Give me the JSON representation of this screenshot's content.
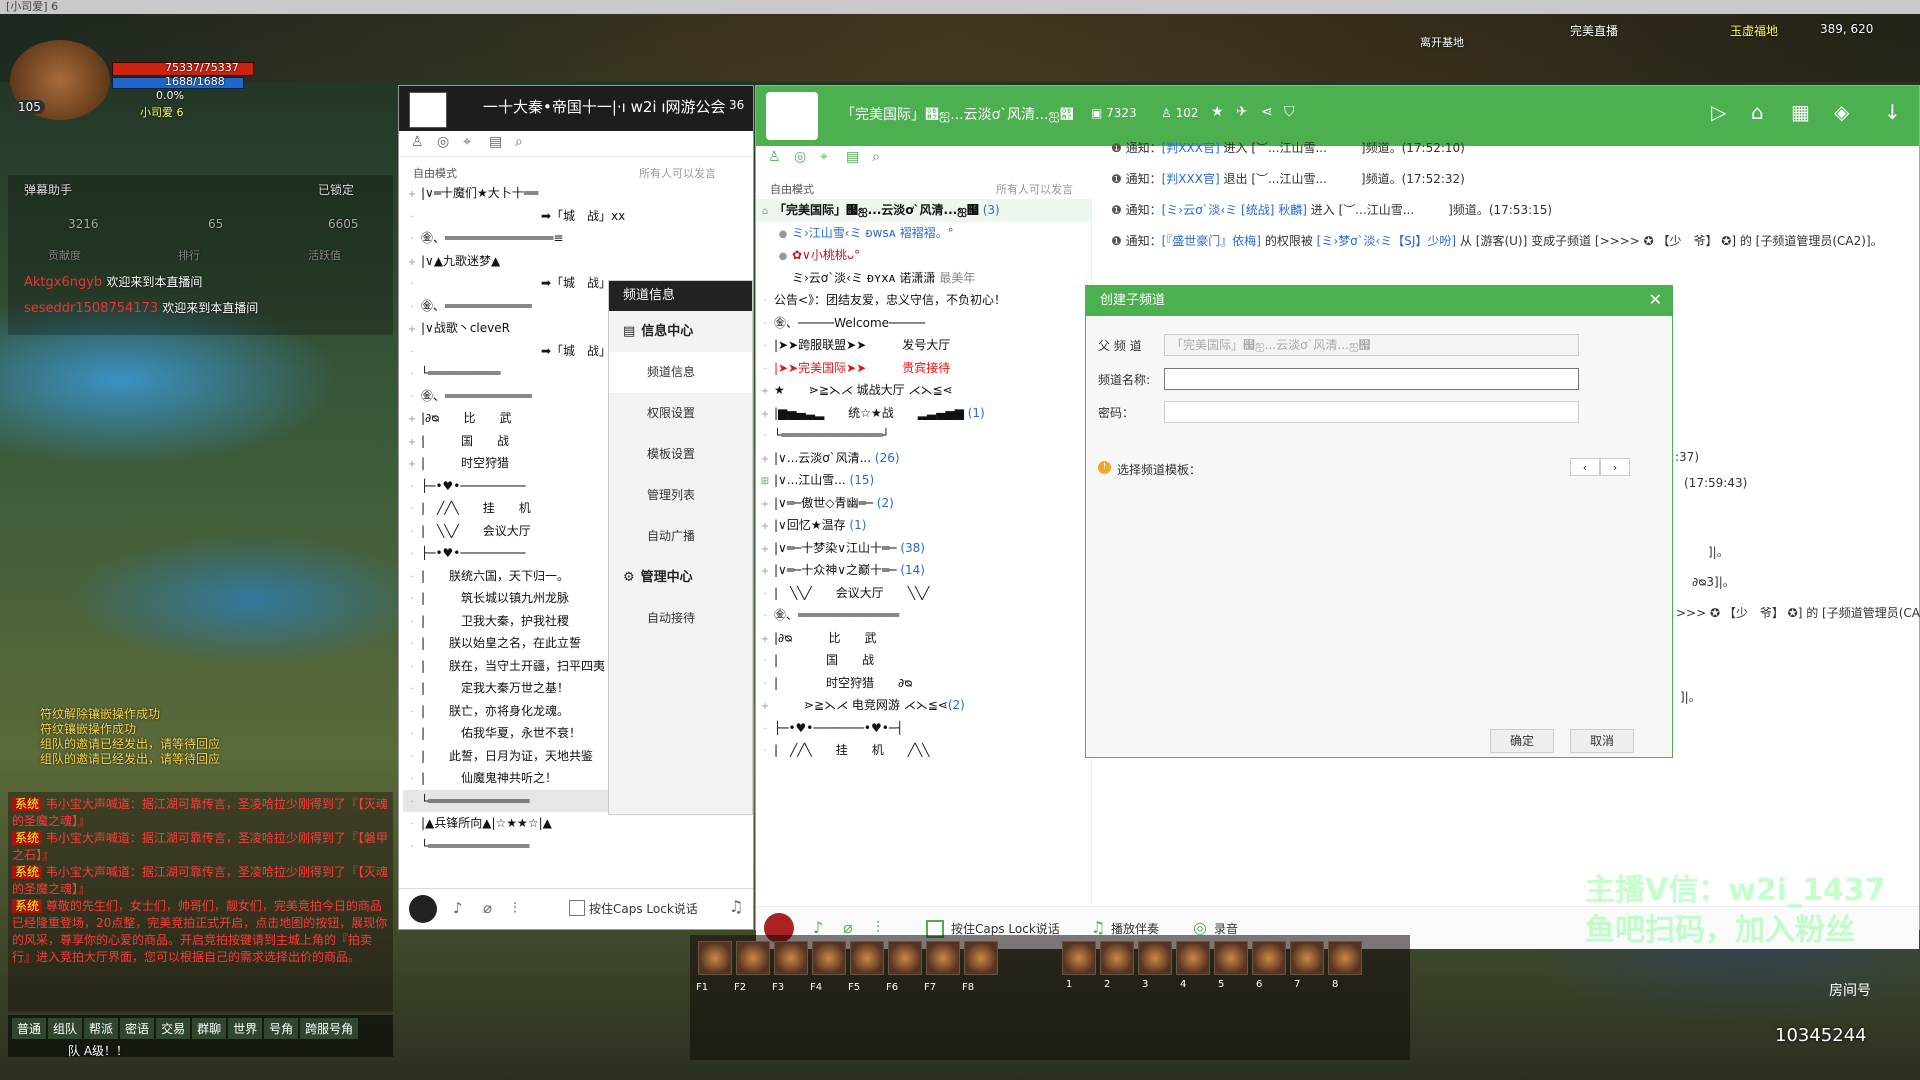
{
  "window_title": "[小司爱] 6",
  "game": {
    "hp": "75337/75337",
    "mp": "1688/1688",
    "exp": "0.0%",
    "level": "105",
    "name": "小司爱 6",
    "top_right_label": "完美直播",
    "coords": "389, 620",
    "server_label": "玉虚福地",
    "base_label": "离开基地"
  },
  "stream": {
    "header_left": "弹幕助手",
    "lock_label": "已锁定",
    "viewers": "3216",
    "fans": "65",
    "likes": "6605",
    "col1": "贡献度",
    "col2": "排行",
    "col3": "活跃值",
    "welcome": [
      {
        "user": "Aktgx6ngyb",
        "text": "欢迎来到本直播间"
      },
      {
        "user": "seseddr1508754173",
        "text": "欢迎来到本直播间"
      }
    ]
  },
  "sysmsgs": [
    "符纹解除镶嵌操作成功",
    "符纹镶嵌操作成功",
    "组队的邀请已经发出，请等待回应",
    "组队的邀请已经发出，请等待回应"
  ],
  "world_chat": [
    {
      "tag": "系统",
      "text": "韦小宝大声喊道：据江湖可靠传言，圣凌哈拉少刚得到了『【灭魂的圣魔之魂】』"
    },
    {
      "tag": "系统",
      "text": "韦小宝大声喊道：据江湖可靠传言，圣凌哈拉少刚得到了『【磐甲之石】』"
    },
    {
      "tag": "系统",
      "text": "韦小宝大声喊道：据江湖可靠传言，圣凌哈拉少刚得到了『【灭魂的圣魔之魂】』"
    },
    {
      "tag": "系统",
      "text": "尊敬的先生们，女士们，帅哥们，靓女们，完美竞拍今日的商品已经隆重登场，20点整，完美竞拍正式开启，点击地图的按钮，展现你的风采，尊享你的心爱的商品。开启竞拍按键请到主城上角的『拍卖行』进入竞拍大厅界面，您可以根据自己的需求选择出价的商品。"
    }
  ],
  "chat_tabs": [
    "普通",
    "组队",
    "帮派",
    "密语",
    "交易",
    "群聊",
    "世界",
    "号角",
    "跨服号角"
  ],
  "chat_input_prefix": "队 A级！！",
  "yy1": {
    "title": "一十大秦•帝国十一|·ı w2i ı网游公会",
    "title_num": "36",
    "mode": "自由模式",
    "speak_rule": "所有人可以发言",
    "rows": [
      "|∨═十魔们★大卜十══",
      "➡「城　战」xx",
      "㊎、═══════════════≡",
      "|∨▲九歌迷梦▲",
      "➡「城　战」xx",
      "㊎、════════════",
      "|∨战歌丶cleveR",
      "➡「城　战」",
      "└══════════",
      "㊎、════════════",
      "|∂ᴓ　　比　　武",
      "|　　　国　　战",
      "|　　　时空狩猎",
      "├─•♥•─────────",
      "|　╱╱╲　　挂　　机",
      "|　╲╲╱　　会议大厅",
      "├─•♥•─────────",
      "|　　朕统六国，天下归一。",
      "|　　　筑长城以镇九州龙脉",
      "|　　　卫我大秦，护我社稷",
      "|　　朕以始皇之名，在此立誓",
      "|　　朕在，当守土开疆，扫平四夷",
      "|　　　定我大秦万世之基！",
      "|　　朕亡，亦将身化龙魂。",
      "|　　　佑我华夏，永世不衰！",
      "|　　此誓，日月为证，天地共鉴",
      "|　　　仙魔鬼神共听之！",
      "└══════════════",
      "|▲兵锋所向▲|☆★★☆|▲",
      "└══════════════"
    ],
    "bottom_caps": "按住Caps Lock说话"
  },
  "menu": {
    "header": "频道信息",
    "group1": "信息中心",
    "items1": [
      "频道信息",
      "权限设置",
      "模板设置",
      "管理列表",
      "自动广播",
      "自动接待"
    ],
    "group2": "管理中心"
  },
  "yy2": {
    "title": "「完美国际」஧ஐ...云淡ơ`风清...ஐ஧",
    "channel_id": "7323",
    "online": "102",
    "mode": "自由模式",
    "speak_rule": "所有人可以发言",
    "list": [
      {
        "text": "「完美国际」஧ஐ...云淡ơ`风清...ஐ஧",
        "count": "(3)"
      },
      {
        "text": "ミ›江山雪‹ミ ᴆᴡsᴀ 褶褶褶。°",
        "count": ""
      },
      {
        "text": "✿∨小桃桃ᴗ°",
        "count": ""
      },
      {
        "text": "ミ›云ơ`淡‹ミ ᴆʏxᴀ 诺潇潇",
        "count": "最美年"
      },
      {
        "text": "公告<》：团结友爱，忠义守信，不负初心！",
        "count": ""
      },
      {
        "text": "㊎、─────Welcome─────",
        "count": ""
      },
      {
        "text": "|➤➤跨服联盟➤➤　　　发号大厅",
        "count": ""
      },
      {
        "text": "|➤➤完美国际➤➤　　　贵宾接待",
        "count": ""
      },
      {
        "text": "★　　⋗≧⋋⋌ 城战大厅 ⋌⋋≦⋖",
        "count": ""
      },
      {
        "text": "|▆▅▄▃▂　　统☆★战　　▂▃▄▅▆",
        "count": "(1)"
      },
      {
        "text": "└══════════════┘",
        "count": ""
      },
      {
        "text": "|∨...云淡ơ`风清...",
        "count": "(26)"
      },
      {
        "text": "|∨...江山雪...",
        "count": "(15)"
      },
      {
        "text": "|∨═─傲世◇青幽═─",
        "count": "(2)"
      },
      {
        "text": "|∨回忆★温存",
        "count": "(1)"
      },
      {
        "text": "|∨═─十梦染∨江山十═─",
        "count": "(38)"
      },
      {
        "text": "|∨═─十众神∨之巅十═─",
        "count": "(14)"
      },
      {
        "text": "|　╲╲╱　　会议大厅　　╲╲╱",
        "count": ""
      },
      {
        "text": "㊎、══════════════",
        "count": ""
      },
      {
        "text": "|∂ᴓ　　　比　　武",
        "count": ""
      },
      {
        "text": "|　　　　国　　战",
        "count": ""
      },
      {
        "text": "|　　　　时空狩猎　　∂ᴓ",
        "count": ""
      },
      {
        "text": "⋗≧⋋⋌ 电竞网游 ⋌⋋≦⋖",
        "count": "(2)"
      },
      {
        "text": "├─•♥•───────•♥•─┤",
        "count": ""
      },
      {
        "text": "|　╱╱╲　　挂　　机　　╱╲╲",
        "count": ""
      }
    ],
    "notices": [
      {
        "pre": "通知：",
        "user": "[判XXX官]",
        "action": "进入",
        "chan": "[︶...江山雪...",
        "tail": "]频道。(17:52:10)"
      },
      {
        "pre": "通知：",
        "user": "[判XXX官]",
        "action": "退出",
        "chan": "[︶...江山雪...",
        "tail": "]频道。(17:52:32)"
      },
      {
        "pre": "通知：",
        "user": "[ミ›云ơ`淡‹ミ [统战] 秋麟]",
        "action": "进入",
        "chan": "[︶...江山雪...",
        "tail": "]频道。(17:53:15)"
      },
      {
        "pre": "通知：",
        "user": "[『盛世豪门』依梅]",
        "action": "的权限被",
        "chan": "[ミ›梦ơ`淡‹ミ【SJ】少吩]",
        "tail": "从 [游客(U)] 变成子频道 [>>>> ✪ 【少　爷】 ✪] 的 [子频道管理员(CA2)]。"
      }
    ],
    "right_frag": [
      ":37)",
      "(17:59:43)",
      "]|。",
      "∂ᴓ3]|。",
      ">>> ✪ 【少　爷】 ✪] 的 [子频道管理员(CA",
      "]|。"
    ],
    "bottom": {
      "caps": "按住Caps Lock说话",
      "music": "播放伴奏",
      "record": "录音"
    }
  },
  "dialog": {
    "title": "创建子频道",
    "parent_label": "父 频 道",
    "parent_value": "「完美国际」஧ஐ...云淡ơ`风清...ஐ஧",
    "name_label": "频道名称:",
    "name_value": "",
    "pwd_label": "密码：",
    "pwd_value": "",
    "template_label": "选择频道模板：",
    "ok": "确定",
    "cancel": "取消"
  },
  "hotbar": {
    "keys": [
      "F1",
      "F2",
      "F3",
      "F4",
      "F5",
      "F6",
      "F7",
      "F8",
      "1",
      "2",
      "3",
      "4",
      "5",
      "6",
      "7",
      "8"
    ]
  },
  "overlay": {
    "watermark1": "主播V信：w2i_1437",
    "watermark2": "鱼吧扫码，加入粉丝",
    "room_label": "房间号",
    "room_number": "10345244"
  }
}
